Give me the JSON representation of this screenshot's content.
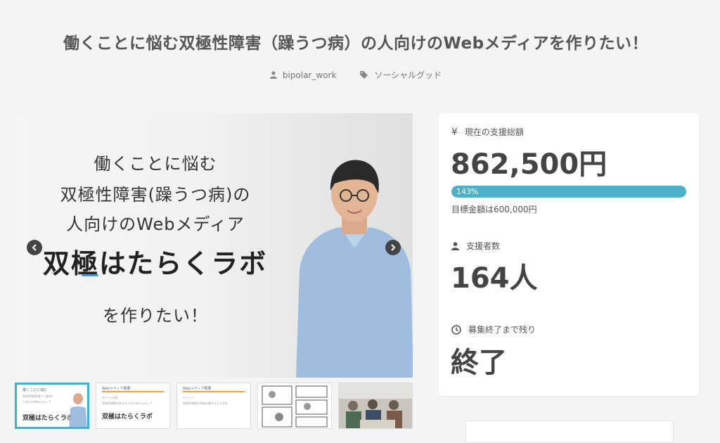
{
  "page": {
    "title": "働くことに悩む双極性障害（躁うつ病）の人向けのWebメディアを作りたい！",
    "author": "bipolar_work",
    "category": "ソーシャルグッド"
  },
  "hero": {
    "line1": "働くことに悩む",
    "line2": "双極性障害(躁うつ病)の",
    "line3": "人向けのWebメディア",
    "logo": "双極はたらくラボ",
    "line4": "を作りたい！"
  },
  "thumbnails": [
    {
      "title": "働くことに悩む",
      "line1": "双極性障害(躁うつ病)の",
      "line2": "人向けのWebメディア",
      "big": "双極はたらくラボ"
    },
    {
      "title": "Webメディア概要",
      "line1": "タイトル(仮)",
      "line2": "双極性障害を抱える人のためのメディア",
      "big": "双極はたらくラボ"
    },
    {
      "title": "Webメディア概要",
      "line1": "ビジョン",
      "line2": "双極性障害の多様な働き方と工夫を",
      "big": ""
    },
    {
      "title": "",
      "line1": "",
      "line2": "",
      "big": ""
    },
    {
      "title": "",
      "line1": "",
      "line2": "",
      "big": ""
    }
  ],
  "funding": {
    "currency_icon": "¥",
    "total_label": "現在の支援総額",
    "total_amount": "862,500円",
    "progress_percent": 143,
    "progress_label": "143%",
    "goal_text": "目標金額は600,000円",
    "supporters_label": "支援者数",
    "supporters": "164人",
    "remaining_label": "募集終了まで残り",
    "remaining": "終了"
  },
  "colors": {
    "accent": "#4db0c9",
    "active_thumb": "#44b0d0",
    "text": "#444444"
  }
}
